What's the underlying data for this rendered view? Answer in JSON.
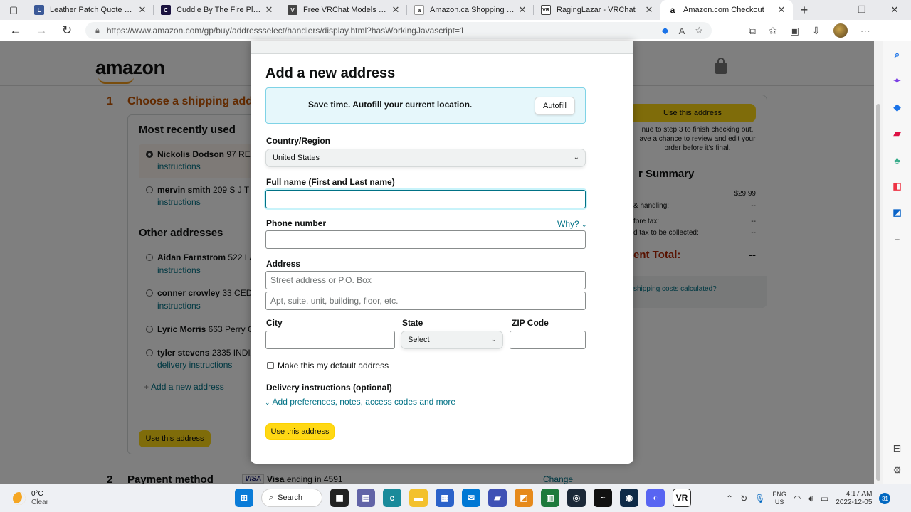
{
  "browser": {
    "tabs": [
      {
        "title": "Leather Patch Quote Reque",
        "favicon_color": "#3b5998",
        "favicon_glyph": "L",
        "active": false
      },
      {
        "title": "Cuddle By The Fire Place",
        "favicon_color": "#1b1340",
        "favicon_glyph": "C",
        "active": false
      },
      {
        "title": "Free VRChat Models & Avat",
        "favicon_color": "#444444",
        "favicon_glyph": "V",
        "active": false
      },
      {
        "title": "Amazon.ca Shopping Cart",
        "favicon_color": "#111111",
        "favicon_glyph": "a",
        "active": false
      },
      {
        "title": "RagingLazar - VRChat",
        "favicon_color": "#222222",
        "favicon_glyph": "VR",
        "active": false
      },
      {
        "title": "Amazon.com Checkout",
        "favicon_color": "#111111",
        "favicon_glyph": "a",
        "active": true
      }
    ],
    "url": "https://www.amazon.com/gp/buy/addressselect/handlers/display.html?hasWorkingJavascript=1"
  },
  "page": {
    "logo": "amazon",
    "step1": {
      "number": "1",
      "title": "Choose a shipping addre"
    },
    "recent_heading": "Most recently used",
    "recent_addresses": [
      {
        "name": "Nickolis Dodson",
        "street": "97 REID",
        "link": "instructions",
        "selected": true
      },
      {
        "name": "mervin smith",
        "street": "209 S J T S",
        "link": "instructions",
        "selected": false
      }
    ],
    "other_heading": "Other addresses",
    "other_addresses": [
      {
        "name": "Aidan Farnstrom",
        "street": "522 LA",
        "link": "instructions"
      },
      {
        "name": "conner crowley",
        "street": "33 CEDA",
        "link": "instructions"
      },
      {
        "name": "Lyric Morris",
        "street": "663 Perry C",
        "link": ""
      },
      {
        "name": "tyler stevens",
        "street": "2335 INDIA",
        "link": "delivery instructions"
      }
    ],
    "add_new_link": "Add a new address",
    "use_address_button": "Use this address",
    "step2": {
      "number": "2",
      "title": "Payment method",
      "card_brand": "VISA",
      "card_text_bold": "Visa",
      "card_text": "ending in 4591",
      "change": "Change"
    },
    "summary": {
      "button": "Use this address",
      "note_lines": [
        "nue to step 3 to finish checking out.",
        "ave a chance to review and edit your",
        "order before it's final."
      ],
      "title": "r Summary",
      "rows": [
        {
          "label": "",
          "value": "$29.99"
        },
        {
          "label": "& handling:",
          "value": "--"
        },
        {
          "label": "fore tax:",
          "value": "--"
        },
        {
          "label": "d tax to be collected:",
          "value": "--"
        }
      ],
      "total_label": "ent Total:",
      "total_value": "--",
      "foot_link": "shipping costs calculated?"
    }
  },
  "modal": {
    "title": "Add a new address",
    "autofill_text": "Save time. Autofill your current location.",
    "autofill_button": "Autofill",
    "country_label": "Country/Region",
    "country_value": "United States",
    "fullname_label": "Full name (First and Last name)",
    "fullname_value": "",
    "phone_label": "Phone number",
    "phone_why": "Why?",
    "phone_value": "",
    "address_label": "Address",
    "address_line1_placeholder": "Street address or P.O. Box",
    "address_line2_placeholder": "Apt, suite, unit, building, floor, etc.",
    "city_label": "City",
    "state_label": "State",
    "state_value": "Select",
    "zip_label": "ZIP Code",
    "default_checkbox_label": "Make this my default address",
    "delivery_heading": "Delivery instructions (optional)",
    "delivery_link": "Add preferences, notes, access codes and more",
    "submit_button": "Use this address"
  },
  "taskbar": {
    "weather_temp": "0°C",
    "weather_desc": "Clear",
    "search_label": "Search",
    "lang_top": "ENG",
    "lang_bottom": "US",
    "time": "4:17 AM",
    "date": "2022-12-05",
    "notification_count": "31"
  }
}
